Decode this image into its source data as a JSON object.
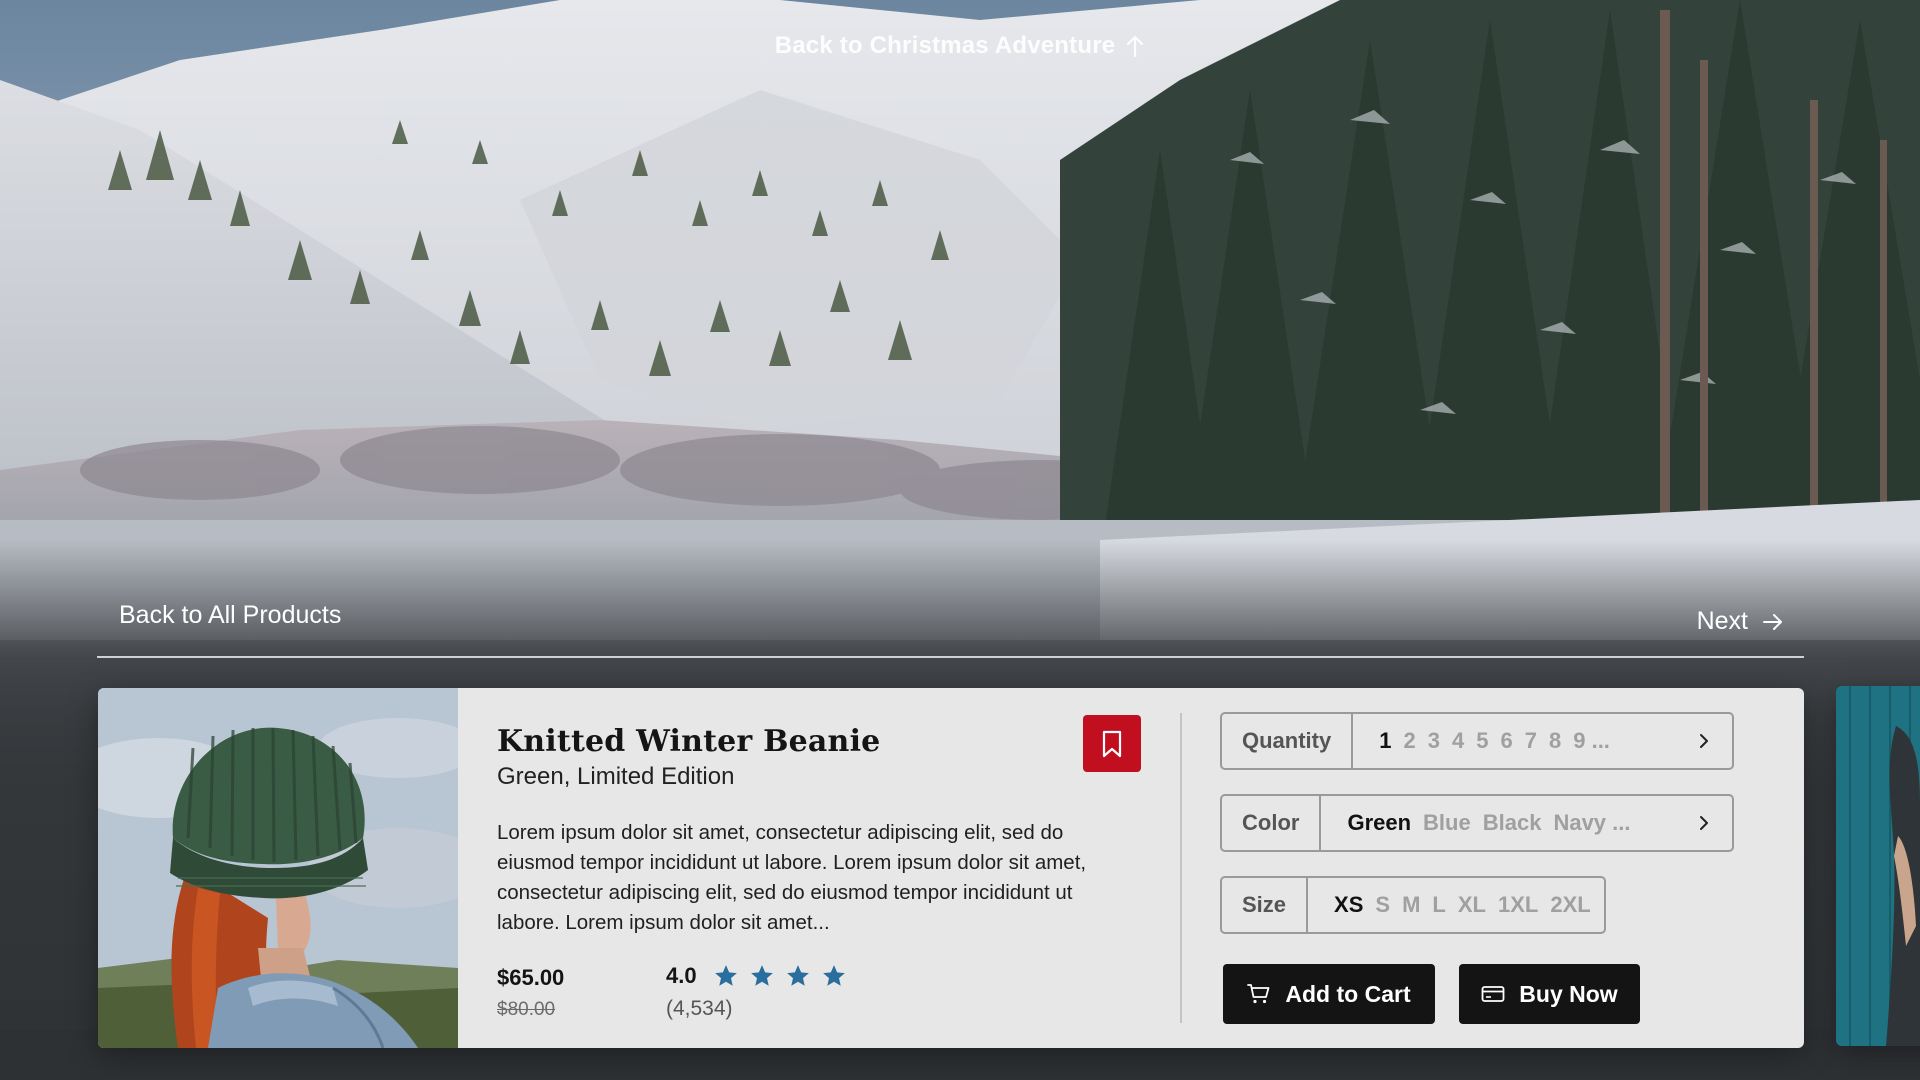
{
  "top_link": {
    "label": "Back to Christmas Adventure",
    "icon": "arrow-up-icon"
  },
  "nav": {
    "back_label": "Back to All Products",
    "next_label": "Next",
    "next_icon": "arrow-right-icon"
  },
  "product": {
    "title": "Knitted Winter Beanie",
    "subtitle": "Green, Limited Edition",
    "description": "Lorem ipsum dolor sit amet, consectetur adipiscing elit, sed do eiusmod tempor incididunt ut labore. Lorem ipsum dolor sit amet, consectetur adipiscing elit, sed do eiusmod tempor incididunt ut labore. Lorem ipsum dolor sit amet...",
    "price": "$65.00",
    "original_price": "$80.00",
    "rating": "4.0",
    "rating_stars": 4,
    "review_count": "(4,534)",
    "bookmark_icon": "bookmark-icon"
  },
  "selectors": {
    "quantity": {
      "label": "Quantity",
      "options": [
        "1",
        "2",
        "3",
        "4",
        "5",
        "6",
        "7",
        "8",
        "9 ..."
      ],
      "selected": "1"
    },
    "color": {
      "label": "Color",
      "options": [
        "Green",
        "Blue",
        "Black",
        "Navy ..."
      ],
      "selected": "Green"
    },
    "size": {
      "label": "Size",
      "options": [
        "XS",
        "S",
        "M",
        "L",
        "XL",
        "1XL",
        "2XL"
      ],
      "selected": "XS"
    }
  },
  "actions": {
    "add_to_cart": "Add to Cart",
    "buy_now": "Buy Now"
  },
  "colors": {
    "accent_red": "#c10f1f",
    "star_blue": "#2a6e9e",
    "button_dark": "#141414",
    "card_bg": "#e7e7e7"
  }
}
